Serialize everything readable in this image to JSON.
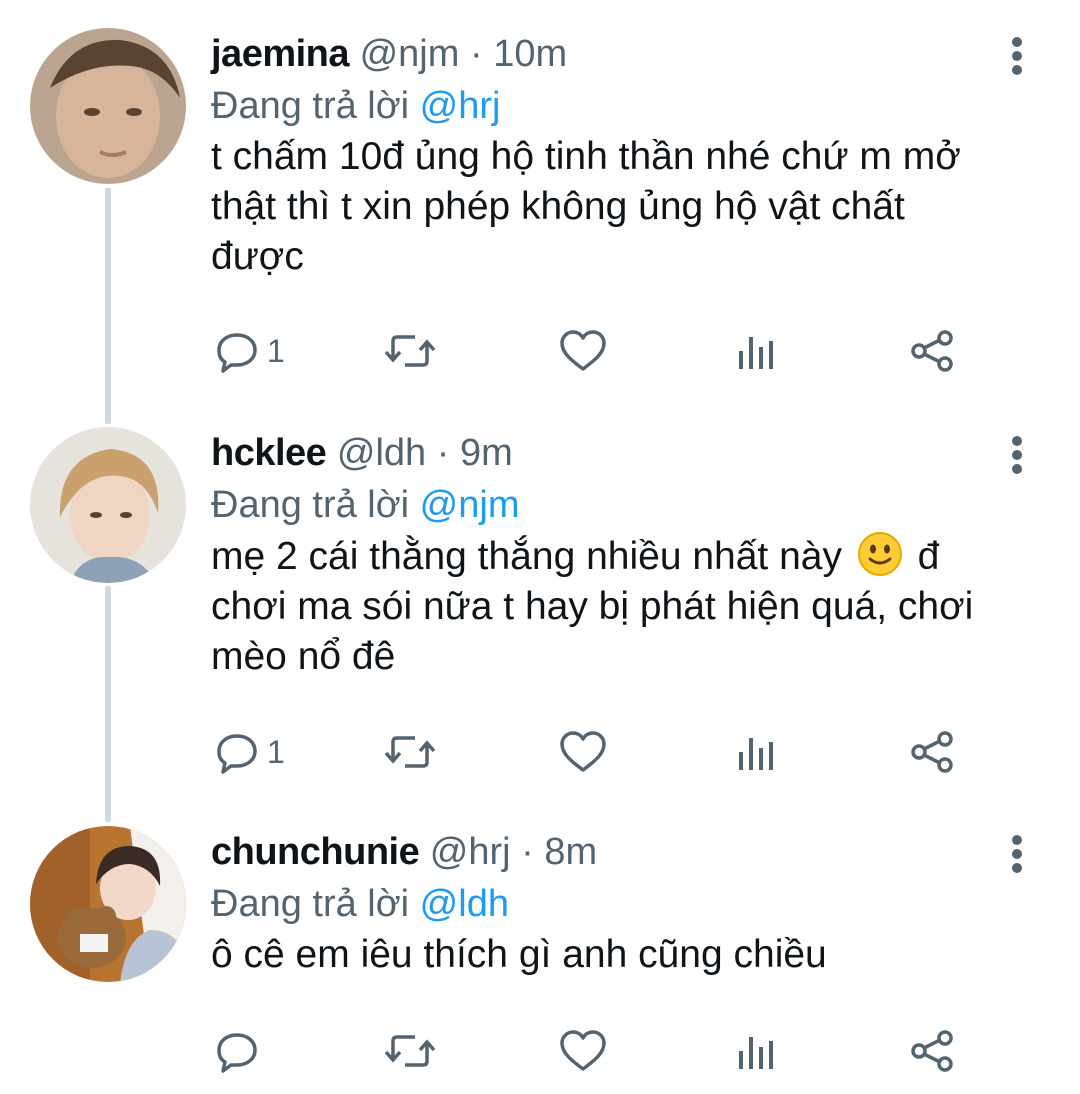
{
  "tweets": [
    {
      "display_name": "jaemina",
      "handle": "@njm",
      "separator": "·",
      "time": "10m",
      "reply_prefix": "Đang trả lời",
      "reply_to": "@hrj",
      "text_lines": [
        "t chấm 10đ ủng hộ tinh thần nhé chứ m mở",
        "thật thì t xin phép không ủng hộ vật chất",
        "được"
      ],
      "reply_count": "1",
      "avatar_colors": {
        "bg": "#bca590",
        "skin": "#d8b59a",
        "hair": "#5b4334"
      }
    },
    {
      "display_name": "hcklee",
      "handle": "@ldh",
      "separator": "·",
      "time": "9m",
      "reply_prefix": "Đang trả lời",
      "reply_to": "@njm",
      "text_part1": "mẹ 2 cái thằng thắng nhiều nhất này",
      "text_part2": "đ",
      "text_lines": [
        "chơi ma sói nữa t hay bị phát hiện quá, chơi",
        "mèo nổ đê"
      ],
      "emoji": "slightly-smiling-face",
      "reply_count": "1",
      "avatar_colors": {
        "bg": "#e6e2dc",
        "skin": "#f0d6c2",
        "hair": "#caa06c"
      }
    },
    {
      "display_name": "chunchunie",
      "handle": "@hrj",
      "separator": "·",
      "time": "8m",
      "reply_prefix": "Đang trả lời",
      "reply_to": "@ldh",
      "text_lines": [
        "ô cê em iêu thích gì anh cũng chiều"
      ],
      "reply_count": "",
      "avatar_colors": {
        "bg": "#b9752f",
        "skin": "#f1d8c8",
        "hair": "#3a2b25"
      }
    }
  ],
  "icons": {
    "reply": "reply-icon",
    "retweet": "retweet-icon",
    "like": "heart-icon",
    "views": "views-icon",
    "share": "share-icon",
    "more": "more-vertical-icon"
  },
  "colors": {
    "text": "#0f1419",
    "muted": "#536471",
    "mention": "#1d9bf0",
    "thread_line": "#cfd9de"
  }
}
